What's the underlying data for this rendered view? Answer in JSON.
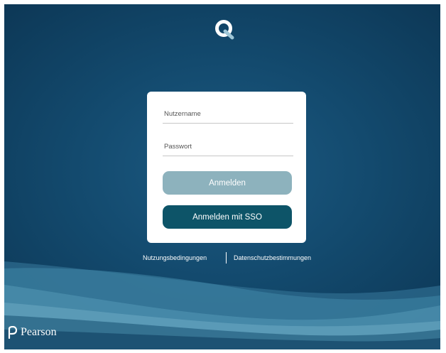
{
  "app": {
    "logo_icon": "q-app-logo-icon",
    "accent_color": "#0d5468"
  },
  "login_form": {
    "username_placeholder": "Nutzername",
    "password_placeholder": "Passwort",
    "login_label": "Anmelden",
    "sso_label": "Anmelden mit SSO"
  },
  "footer_links": {
    "terms": "Nutzungsbedingungen",
    "privacy": "Datenschutzbestimmungen"
  },
  "brand": {
    "icon": "pearson-p-icon",
    "name": "Pearson"
  }
}
